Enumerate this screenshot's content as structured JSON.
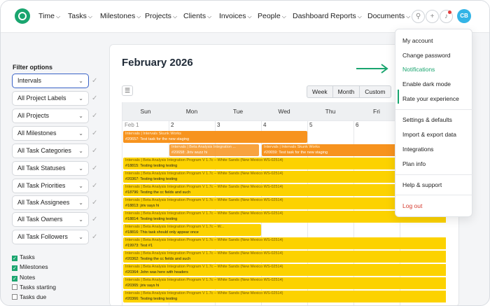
{
  "nav": {
    "items": [
      {
        "label": "Time",
        "chevron": true
      },
      {
        "label": "Tasks",
        "chevron": true
      },
      {
        "label": "Milestones",
        "chevron": true
      },
      {
        "label": "Projects",
        "chevron": true
      },
      {
        "label": "Clients",
        "chevron": true
      },
      {
        "label": "Invoices",
        "chevron": true
      },
      {
        "label": "People",
        "chevron": true
      },
      {
        "label": "Dashboard",
        "chevron": false
      },
      {
        "label": "Reports",
        "chevron": true
      },
      {
        "label": "Documents",
        "chevron": true
      }
    ],
    "avatar_initials": "CB",
    "accent": "#1aa56f"
  },
  "sidebar": {
    "title": "Filter options",
    "filters": [
      "Intervals",
      "All Project Labels",
      "All Projects",
      "All Milestones",
      "All Task Categories",
      "All Task Statuses",
      "All Task Priorities",
      "All Task Assignees",
      "All Task Owners",
      "All Task Followers"
    ],
    "checkboxes": [
      {
        "label": "Tasks",
        "checked": true
      },
      {
        "label": "Milestones",
        "checked": true
      },
      {
        "label": "Notes",
        "checked": true
      },
      {
        "label": "Tasks starting",
        "checked": false
      },
      {
        "label": "Tasks due",
        "checked": false
      }
    ]
  },
  "calendar": {
    "title": "February 2026",
    "views": [
      "Week",
      "Month",
      "Custom"
    ],
    "days": [
      "Sun",
      "Mon",
      "Tue",
      "Wed",
      "Thu",
      "Fri"
    ],
    "dates": [
      "Feb 1",
      "2",
      "3",
      "4",
      "5",
      "6"
    ],
    "events": [
      {
        "l1": "Intervals | Intervals Skunk Works",
        "l2": "#20657: Test task for the new staging",
        "color": "orange"
      },
      {
        "l1": "Intervals | Beta Analysis Integration ...",
        "l2": "#20658: Jiriv wuzz hi",
        "color": "orange"
      },
      {
        "l1": "Intervals | Intervals Skunk Works",
        "l2": "#20659: Test task for the new staging",
        "color": "orange"
      },
      {
        "l1": "Intervals | Beta Analysis Integration Program V 1.7c – White Sands (New Mexico WS-02514)",
        "l2": "#18815: Testing testing testing",
        "color": "yellow"
      },
      {
        "l1": "Intervals | Beta Analysis Integration Program V 1.7c – White Sands (New Mexico WS-02514)",
        "l2": "#20367: Testing testing testing",
        "color": "yellow"
      },
      {
        "l1": "Intervals | Beta Analysis Integration Program V 1.7c – White Sands (New Mexico WS-02514)",
        "l2": "#18796: Testing the cc fields and such",
        "color": "yellow"
      },
      {
        "l1": "Intervals | Beta Analysis Integration Program V 1.7c – White Sands (New Mexico WS-02514)",
        "l2": "#18813: jiriv says hi",
        "color": "yellow"
      },
      {
        "l1": "Intervals | Beta Analysis Integration Program V 1.7c – White Sands (New Mexico WS-02514)",
        "l2": "#18814: Testing testing testing",
        "color": "yellow"
      },
      {
        "l1": "Intervals | Beta Analysis Integration Program V 1.7c – W...",
        "l2": "#18816: This task should only appear once",
        "color": "yellow"
      },
      {
        "l1": "Intervals | Beta Analysis Integration Program V 1.7c – White Sands (New Mexico WS-02514)",
        "l2": "#19973: Test #1",
        "color": "yellow"
      },
      {
        "l1": "Intervals | Beta Analysis Integration Program V 1.7c – White Sands (New Mexico WS-02514)",
        "l2": "#20362: Testing the cc fields and such",
        "color": "yellow"
      },
      {
        "l1": "Intervals | Beta Analysis Integration Program V 1.7c – White Sands (New Mexico WS-02514)",
        "l2": "#20364: John was here with headers",
        "color": "yellow"
      },
      {
        "l1": "Intervals | Beta Analysis Integration Program V 1.7c – White Sands (New Mexico WS-02514)",
        "l2": "#20365: jiriv says hi",
        "color": "yellow"
      },
      {
        "l1": "Intervals | Beta Analysis Integration Program V 1.7c – White Sands (New Mexico WS-02514)",
        "l2": "#20366: Testing testing testing",
        "color": "yellow"
      }
    ]
  },
  "account_menu": {
    "items": [
      "My account",
      "Change password",
      "Notifications",
      "Enable dark mode",
      "Rate your experience",
      "Settings & defaults",
      "Import & export data",
      "Integrations",
      "Plan info",
      "Help & support",
      "Log out"
    ],
    "active": "Notifications"
  }
}
